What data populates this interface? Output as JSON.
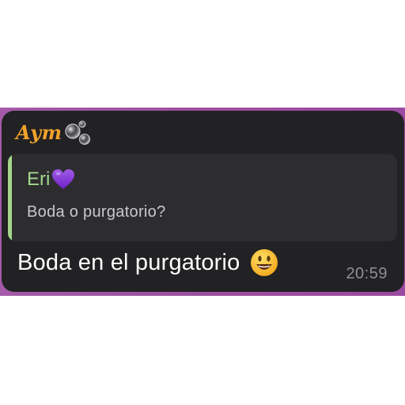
{
  "message": {
    "sender": "Aym",
    "sender_icon": "soap-bubbles-icon",
    "reply": {
      "author": "Eri",
      "author_icon": "purple-heart-icon",
      "text": "Boda o purgatorio?"
    },
    "text": "Boda en el purgatorio",
    "text_icon": "smiling-face-icon",
    "time": "20:59"
  },
  "colors": {
    "chat_background": "#a45aa9",
    "bubble_background": "#222224",
    "sender_name": "#f0a22a",
    "reply_accent": "#a3d68a",
    "time_text": "#8f8f94"
  }
}
